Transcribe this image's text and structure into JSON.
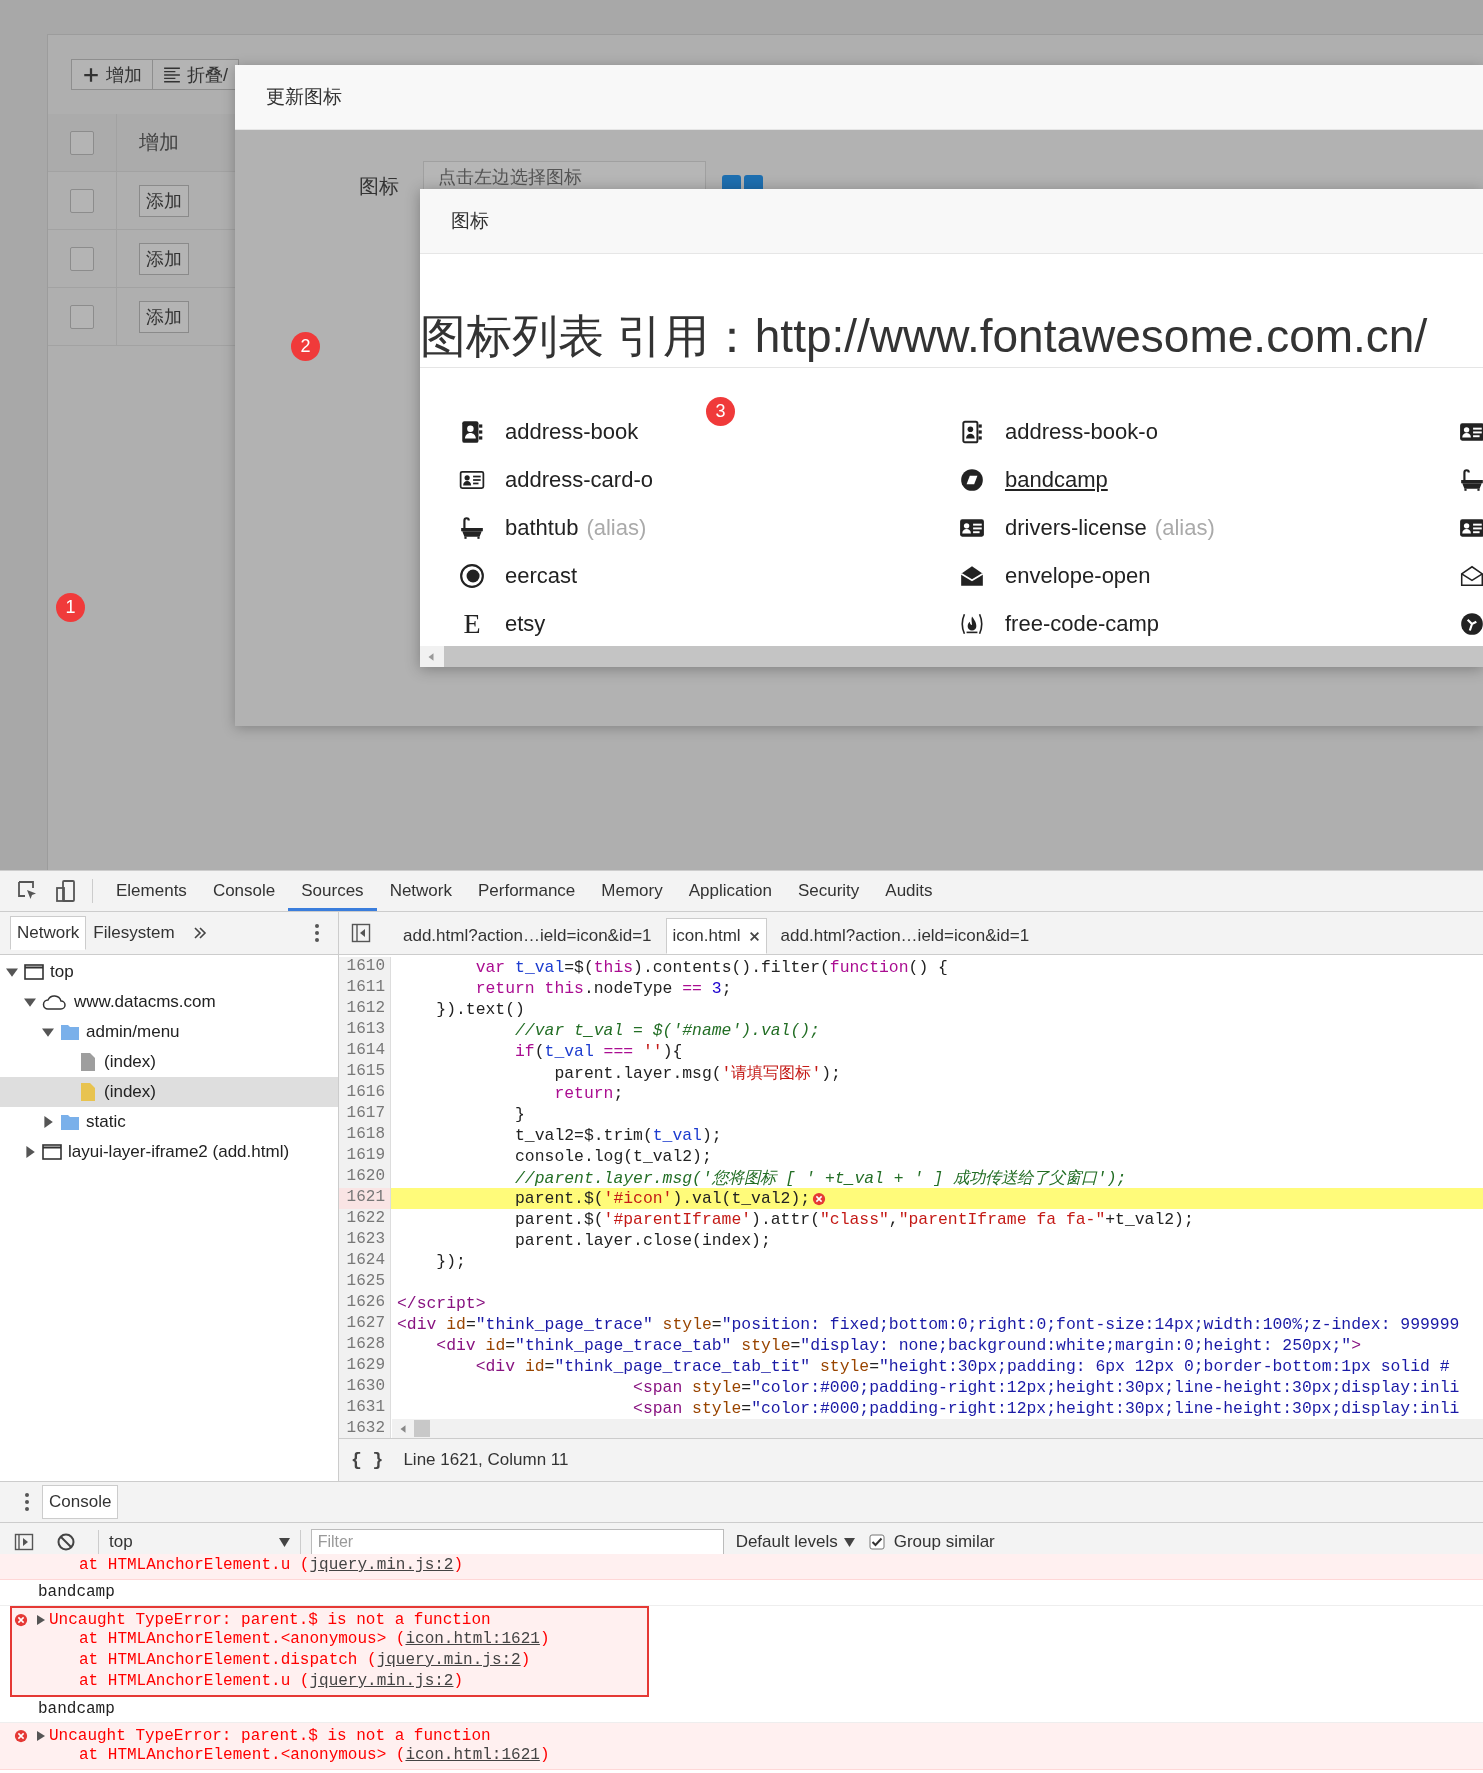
{
  "page": {
    "toolbar": [
      {
        "kind": "add",
        "label": "增加"
      },
      {
        "kind": "fold",
        "label": "折叠/"
      }
    ],
    "table": {
      "header": {
        "checked": false,
        "label": "增加"
      },
      "rows": [
        {
          "checked": false,
          "action": "添加"
        },
        {
          "checked": false,
          "action": "添加"
        },
        {
          "checked": false,
          "action": "添加"
        }
      ]
    }
  },
  "update_dialog": {
    "title": "更新图标",
    "field_label": "图标",
    "placeholder": "点击左边选择图标"
  },
  "icon_dialog": {
    "title": "图标",
    "heading": "图标列表 引用：http://www.fontawesome.com.cn/",
    "icons": [
      {
        "kind": "named",
        "name": "address-book",
        "hovered": false
      },
      {
        "kind": "named",
        "name": "address-book-o",
        "hovered": false
      },
      {
        "kind": "clipped"
      },
      {
        "kind": "named",
        "name": "address-card-o",
        "hovered": false
      },
      {
        "kind": "named",
        "name": "bandcamp",
        "hovered": true
      },
      {
        "kind": "clipped"
      },
      {
        "kind": "named",
        "name": "bathtub",
        "note": "(alias)",
        "hovered": false
      },
      {
        "kind": "named",
        "name": "drivers-license",
        "note": "(alias)",
        "hovered": false
      },
      {
        "kind": "clipped"
      },
      {
        "kind": "named",
        "name": "eercast",
        "hovered": false
      },
      {
        "kind": "named",
        "name": "envelope-open",
        "hovered": false
      },
      {
        "kind": "clipped"
      },
      {
        "kind": "named",
        "name": "etsy",
        "glyph": "E",
        "hovered": false
      },
      {
        "kind": "named",
        "name": "free-code-camp",
        "hovered": false
      },
      {
        "kind": "clipped"
      }
    ]
  },
  "annotations": [
    {
      "label": "1"
    },
    {
      "label": "2"
    },
    {
      "label": "3"
    }
  ],
  "devtools": {
    "tabs": [
      {
        "label": "Elements",
        "selected": false
      },
      {
        "label": "Console",
        "selected": false
      },
      {
        "label": "Sources",
        "selected": true
      },
      {
        "label": "Network",
        "selected": false
      },
      {
        "label": "Performance",
        "selected": false
      },
      {
        "label": "Memory",
        "selected": false
      },
      {
        "label": "Application",
        "selected": false
      },
      {
        "label": "Security",
        "selected": false
      },
      {
        "label": "Audits",
        "selected": false
      }
    ],
    "navigator": {
      "tabs": [
        {
          "label": "Network",
          "selected": true
        },
        {
          "label": "Filesystem",
          "selected": false
        }
      ],
      "tree": [
        {
          "kind": "frame",
          "label": "top",
          "expanded": true,
          "selected": false,
          "children": [
            {
              "kind": "domain",
              "label": "www.datacms.com",
              "expanded": true,
              "selected": false,
              "children": [
                {
                  "kind": "folder",
                  "label": "admin/menu",
                  "expanded": true,
                  "selected": false,
                  "children": [
                    {
                      "kind": "file",
                      "label": "(index)",
                      "color": "#9e9e9e",
                      "selected": false
                    },
                    {
                      "kind": "file",
                      "label": "(index)",
                      "color": "#e8c34f",
                      "selected": true
                    }
                  ]
                },
                {
                  "kind": "folder",
                  "label": "static",
                  "expanded": false,
                  "selected": false
                }
              ]
            },
            {
              "kind": "frame",
              "label": "layui-layer-iframe2 (add.html)",
              "expanded": false,
              "selected": false
            }
          ]
        }
      ]
    },
    "editor": {
      "tabs": [
        {
          "label": "add.html?action…ield=icon&id=1",
          "selected": false,
          "closable": false
        },
        {
          "label": "icon.html",
          "selected": true,
          "closable": true
        },
        {
          "label": "add.html?action…ield=icon&id=1",
          "selected": false,
          "closable": false
        }
      ],
      "lines": [
        {
          "number": "1610",
          "highlighted": false,
          "error": false,
          "tokens": [
            {
              "kind": "keyword",
              "text": "        var"
            },
            {
              "kind": "var",
              "text": " t_val"
            },
            {
              "kind": "plain",
              "text": "=$("
            },
            {
              "kind": "keyword",
              "text": "this"
            },
            {
              "kind": "plain",
              "text": ").contents().filter("
            },
            {
              "kind": "keyword",
              "text": "function"
            },
            {
              "kind": "plain",
              "text": "() {"
            }
          ]
        },
        {
          "number": "1611",
          "highlighted": false,
          "error": false,
          "tokens": [
            {
              "kind": "keyword",
              "text": "        return this"
            },
            {
              "kind": "plain",
              "text": ".nodeType "
            },
            {
              "kind": "op",
              "text": "== "
            },
            {
              "kind": "number",
              "text": "3"
            },
            {
              "kind": "plain",
              "text": ";"
            }
          ]
        },
        {
          "number": "1612",
          "highlighted": false,
          "error": false,
          "tokens": [
            {
              "kind": "plain",
              "text": "    }).text()"
            }
          ]
        },
        {
          "number": "1613",
          "highlighted": false,
          "error": false,
          "tokens": [
            {
              "kind": "comment",
              "text": "            //var t_val = $('#name').val();"
            }
          ]
        },
        {
          "number": "1614",
          "highlighted": false,
          "error": false,
          "tokens": [
            {
              "kind": "keyword",
              "text": "            if"
            },
            {
              "kind": "plain",
              "text": "("
            },
            {
              "kind": "var",
              "text": "t_val"
            },
            {
              "kind": "op",
              "text": " === "
            },
            {
              "kind": "string",
              "text": "''"
            },
            {
              "kind": "plain",
              "text": "){"
            }
          ]
        },
        {
          "number": "1615",
          "highlighted": false,
          "error": false,
          "tokens": [
            {
              "kind": "plain",
              "text": "                parent.layer.msg("
            },
            {
              "kind": "string",
              "text": "'请填写图标'"
            },
            {
              "kind": "plain",
              "text": ");"
            }
          ]
        },
        {
          "number": "1616",
          "highlighted": false,
          "error": false,
          "tokens": [
            {
              "kind": "keyword",
              "text": "                return"
            },
            {
              "kind": "plain",
              "text": ";"
            }
          ]
        },
        {
          "number": "1617",
          "highlighted": false,
          "error": false,
          "tokens": [
            {
              "kind": "plain",
              "text": "            }"
            }
          ]
        },
        {
          "number": "1618",
          "highlighted": false,
          "error": false,
          "tokens": [
            {
              "kind": "plain",
              "text": "            t_val2=$.trim("
            },
            {
              "kind": "var",
              "text": "t_val"
            },
            {
              "kind": "plain",
              "text": ");"
            }
          ]
        },
        {
          "number": "1619",
          "highlighted": false,
          "error": false,
          "tokens": [
            {
              "kind": "plain",
              "text": "            console.log(t_val2);"
            }
          ]
        },
        {
          "number": "1620",
          "highlighted": false,
          "error": false,
          "tokens": [
            {
              "kind": "comment",
              "text": "            //parent.layer.msg('您将图标 [ ' +t_val + ' ] 成功传送给了父窗口');"
            }
          ]
        },
        {
          "number": "1621",
          "highlighted": true,
          "error": true,
          "tokens": [
            {
              "kind": "plain",
              "text": "            parent.$("
            },
            {
              "kind": "string",
              "text": "'#icon'"
            },
            {
              "kind": "plain",
              "text": ").val(t_val2);"
            }
          ]
        },
        {
          "number": "1622",
          "highlighted": false,
          "error": false,
          "tokens": [
            {
              "kind": "plain",
              "text": "            parent.$("
            },
            {
              "kind": "string",
              "text": "'#parentIframe'"
            },
            {
              "kind": "plain",
              "text": ").attr("
            },
            {
              "kind": "string",
              "text": "\"class\""
            },
            {
              "kind": "plain",
              "text": ","
            },
            {
              "kind": "string",
              "text": "\"parentIframe fa fa-\""
            },
            {
              "kind": "plain",
              "text": "+t_val2);"
            }
          ]
        },
        {
          "number": "1623",
          "highlighted": false,
          "error": false,
          "tokens": [
            {
              "kind": "plain",
              "text": "            parent.layer.close(index);"
            }
          ]
        },
        {
          "number": "1624",
          "highlighted": false,
          "error": false,
          "tokens": [
            {
              "kind": "plain",
              "text": "    });"
            }
          ]
        },
        {
          "number": "1625",
          "highlighted": false,
          "error": false
        },
        {
          "number": "1626",
          "highlighted": false,
          "error": false,
          "tokens": [
            {
              "kind": "tag",
              "text": "</script>"
            }
          ]
        },
        {
          "number": "1627",
          "highlighted": false,
          "error": false,
          "tokens": [
            {
              "kind": "tag",
              "text": "<div"
            },
            {
              "kind": "attr",
              "text": " id"
            },
            {
              "kind": "plain",
              "text": "="
            },
            {
              "kind": "value",
              "text": "\"think_page_trace\""
            },
            {
              "kind": "attr",
              "text": " style"
            },
            {
              "kind": "plain",
              "text": "="
            },
            {
              "kind": "value",
              "text": "\"position: fixed;bottom:0;right:0;font-size:14px;width:100%;z-index: 999999"
            }
          ]
        },
        {
          "number": "1628",
          "highlighted": false,
          "error": false,
          "tokens": [
            {
              "kind": "tag",
              "text": "    <div"
            },
            {
              "kind": "attr",
              "text": " id"
            },
            {
              "kind": "plain",
              "text": "="
            },
            {
              "kind": "value",
              "text": "\"think_page_trace_tab\""
            },
            {
              "kind": "attr",
              "text": " style"
            },
            {
              "kind": "plain",
              "text": "="
            },
            {
              "kind": "value",
              "text": "\"display: none;background:white;margin:0;height: 250px;\""
            },
            {
              "kind": "tag",
              "text": ">"
            }
          ]
        },
        {
          "number": "1629",
          "highlighted": false,
          "error": false,
          "tokens": [
            {
              "kind": "tag",
              "text": "        <div"
            },
            {
              "kind": "attr",
              "text": " id"
            },
            {
              "kind": "plain",
              "text": "="
            },
            {
              "kind": "value",
              "text": "\"think_page_trace_tab_tit\""
            },
            {
              "kind": "attr",
              "text": " style"
            },
            {
              "kind": "plain",
              "text": "="
            },
            {
              "kind": "value",
              "text": "\"height:30px;padding: 6px 12px 0;border-bottom:1px solid #"
            }
          ]
        },
        {
          "number": "1630",
          "highlighted": false,
          "error": false,
          "tokens": [
            {
              "kind": "tag",
              "text": "                        <span"
            },
            {
              "kind": "attr",
              "text": " style"
            },
            {
              "kind": "plain",
              "text": "="
            },
            {
              "kind": "value",
              "text": "\"color:#000;padding-right:12px;height:30px;line-height:30px;display:inli"
            }
          ]
        },
        {
          "number": "1631",
          "highlighted": false,
          "error": false,
          "tokens": [
            {
              "kind": "tag",
              "text": "                        <span"
            },
            {
              "kind": "attr",
              "text": " style"
            },
            {
              "kind": "plain",
              "text": "="
            },
            {
              "kind": "value",
              "text": "\"color:#000;padding-right:12px;height:30px;line-height:30px;display:inli"
            }
          ]
        },
        {
          "number": "1632",
          "highlighted": false,
          "error": false
        }
      ],
      "status": {
        "glyph": "{ }",
        "text": "Line 1621, Column 11"
      }
    },
    "drawer": {
      "tabs": [
        {
          "label": "Console",
          "selected": true
        }
      ],
      "context": "top",
      "filter_placeholder": "Filter",
      "levels": "Default levels",
      "group_similar": {
        "label": "Group similar",
        "checked": true
      },
      "messages": [
        {
          "kind": "error",
          "outlined": false,
          "stack": [
            {
              "before": "at HTMLAnchorElement.u (",
              "link": "jquery.min.js:2",
              "after": ")"
            }
          ]
        },
        {
          "kind": "log",
          "text": "bandcamp",
          "outlined": false
        },
        {
          "kind": "error",
          "title": "Uncaught TypeError: parent.$ is not a function",
          "outlined": true,
          "stack": [
            {
              "before": "at HTMLAnchorElement.<anonymous> (",
              "link": "icon.html:1621",
              "after": ")"
            },
            {
              "before": "at HTMLAnchorElement.dispatch (",
              "link": "jquery.min.js:2",
              "after": ")"
            },
            {
              "before": "at HTMLAnchorElement.u (",
              "link": "jquery.min.js:2",
              "after": ")"
            }
          ]
        },
        {
          "kind": "log",
          "text": "bandcamp",
          "outlined": false
        },
        {
          "kind": "error",
          "title": "Uncaught TypeError: parent.$ is not a function",
          "outlined": false,
          "stack": [
            {
              "before": "at HTMLAnchorElement.<anonymous> (",
              "link": "icon.html:1621",
              "after": ")"
            }
          ]
        }
      ]
    }
  }
}
